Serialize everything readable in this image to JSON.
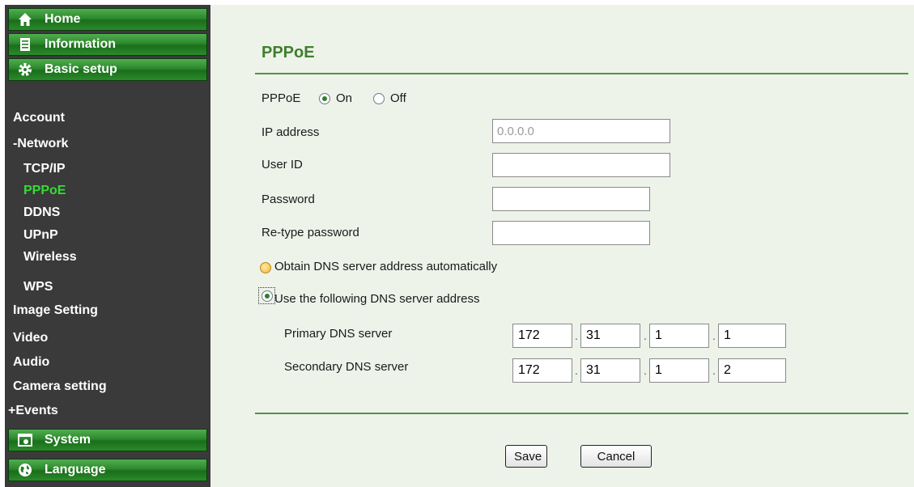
{
  "sidebar": {
    "sections": {
      "home": {
        "label": "Home",
        "icon": "home-icon"
      },
      "information": {
        "label": "Information",
        "icon": "document-icon"
      },
      "basic_setup": {
        "label": "Basic setup",
        "icon": "gear-icon"
      },
      "system": {
        "label": "System",
        "icon": "system-icon"
      },
      "language": {
        "label": "Language",
        "icon": "globe-icon"
      }
    },
    "items": {
      "account": "Account",
      "network": "-Network",
      "tcpip": "TCP/IP",
      "pppoe": "PPPoE",
      "ddns": "DDNS",
      "upnp": "UPnP",
      "wireless": "Wireless",
      "wps": "WPS",
      "image_setting": "Image Setting",
      "video": "Video",
      "audio": "Audio",
      "camera_setting": "Camera setting",
      "events": "+Events"
    }
  },
  "page": {
    "title": "PPPoE",
    "pppoe_label": "PPPoE",
    "on_label": "On",
    "off_label": "Off",
    "pppoe_selected": "On",
    "ip_address_label": "IP address",
    "ip_address_value": "0.0.0.0",
    "user_id_label": "User ID",
    "user_id_value": "",
    "password_label": "Password",
    "password_value": "",
    "retype_password_label": "Re-type password",
    "retype_password_value": "",
    "dns_auto_label": "Obtain DNS server address automatically",
    "dns_manual_label": "Use the following DNS server address",
    "dns_selected": "manual",
    "primary_dns_label": "Primary DNS server",
    "primary_dns": [
      "172",
      "31",
      "1",
      "1"
    ],
    "secondary_dns_label": "Secondary DNS server",
    "secondary_dns": [
      "172",
      "31",
      "1",
      "2"
    ],
    "ip_separator": "."
  },
  "buttons": {
    "save": "Save",
    "cancel": "Cancel"
  },
  "colors": {
    "accent_green": "#3f7f2f",
    "active_menu": "#33dd33",
    "sidebar_bg": "#3a3a3a",
    "content_bg": "#eef3ea"
  }
}
